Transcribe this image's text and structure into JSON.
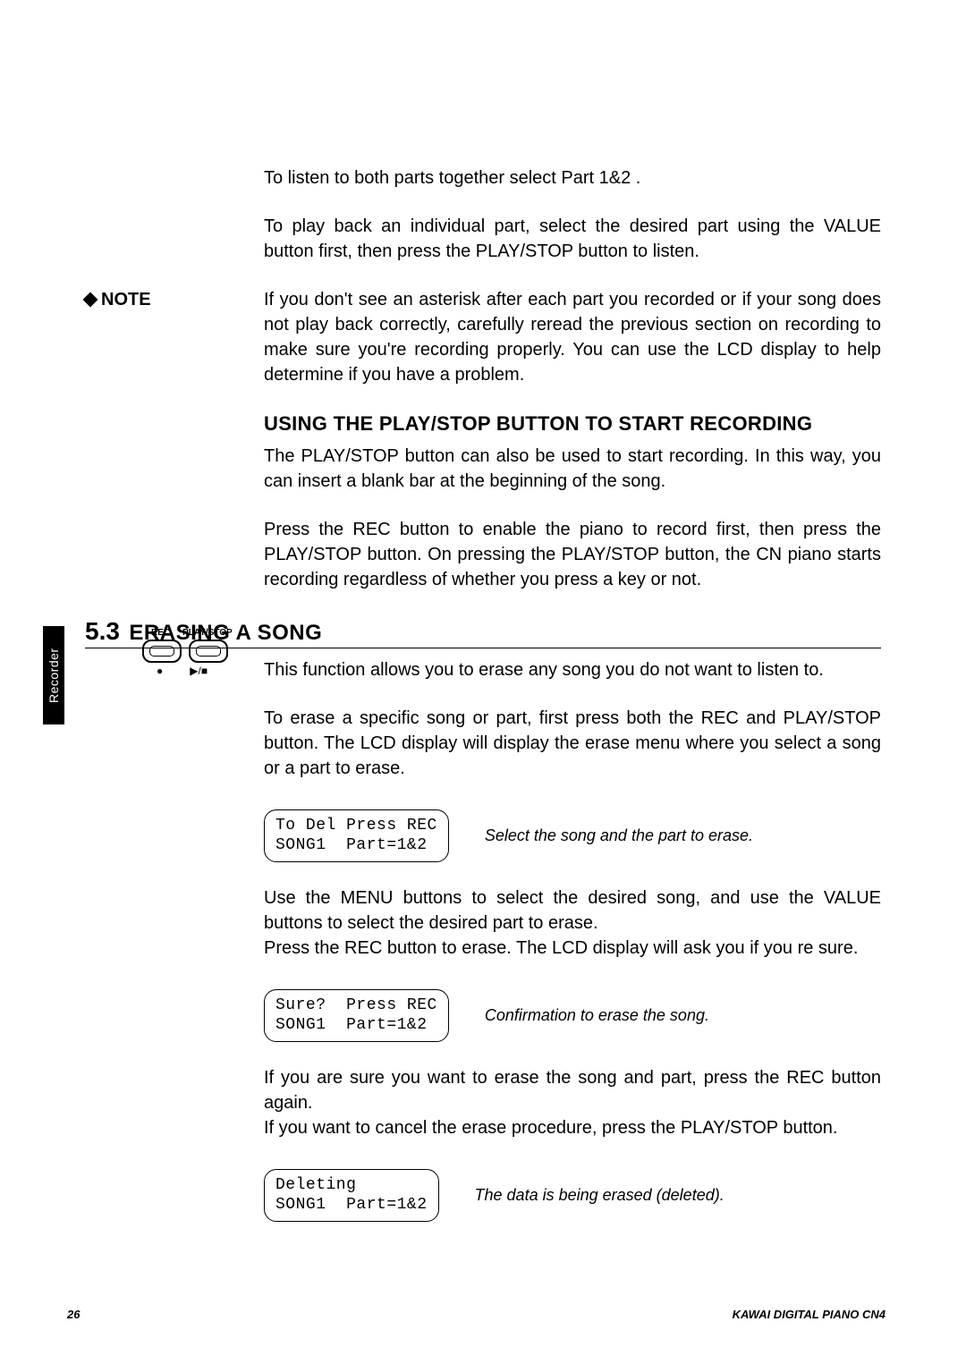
{
  "sideTab": "Recorder",
  "intro": {
    "p1": "To listen to both parts together select  Part 1&2 .",
    "p2": "To play back an individual part, select the desired part using the VALUE button first, then press the PLAY/STOP button to listen."
  },
  "note": {
    "label": "NOTE",
    "text": "If you don't see an asterisk after each part you recorded or if your song does not play back correctly, carefully reread the previous section on recording to make sure you're recording properly.  You can use the LCD display to help determine if you have a problem."
  },
  "subheading": "USING THE PLAY/STOP BUTTON TO START RECORDING",
  "sub": {
    "p1": "The PLAY/STOP button can also be used to start recording.  In this way, you can insert a blank bar at the beginning of the song.",
    "p2": "Press the REC button to enable the piano to record first, then press the PLAY/STOP button.  On pressing the PLAY/STOP button, the CN piano starts recording regardless of whether you press a key or not."
  },
  "section": {
    "num": "5.3",
    "title": "ERASING A SONG"
  },
  "erase": {
    "p1": "This function allows you to erase any song you do not want to listen to.",
    "p2": "To erase a specific song or part, first press both the REC and PLAY/STOP button.  The LCD display will display the erase menu where you select a song or a part to erase.",
    "p3": "Use the MENU buttons to select the desired song, and use the VALUE buttons to select the desired part to erase.",
    "p3b": "Press the REC button to erase.  The LCD display will ask you if you re sure.",
    "p4": "If you are sure you want to erase the song and part, press the REC button again.",
    "p4b": "If you want to cancel the erase procedure, press the PLAY/STOP button."
  },
  "buttons": {
    "rec": "REC",
    "playstop": "PLAY/STOP",
    "recSym": "●",
    "psSym": "▶/■"
  },
  "lcd1": {
    "l1": "To Del Press REC",
    "l2": "SONG1  Part=1&2",
    "caption": "Select the song and the part to erase."
  },
  "lcd2": {
    "l1": "Sure?  Press REC",
    "l2": "SONG1  Part=1&2",
    "caption": "Confirmation to erase the song."
  },
  "lcd3": {
    "l1": "Deleting",
    "l2": "SONG1  Part=1&2",
    "caption": "The data is being erased (deleted)."
  },
  "footer": {
    "page": "26",
    "product": "KAWAI DIGITAL PIANO CN4"
  }
}
